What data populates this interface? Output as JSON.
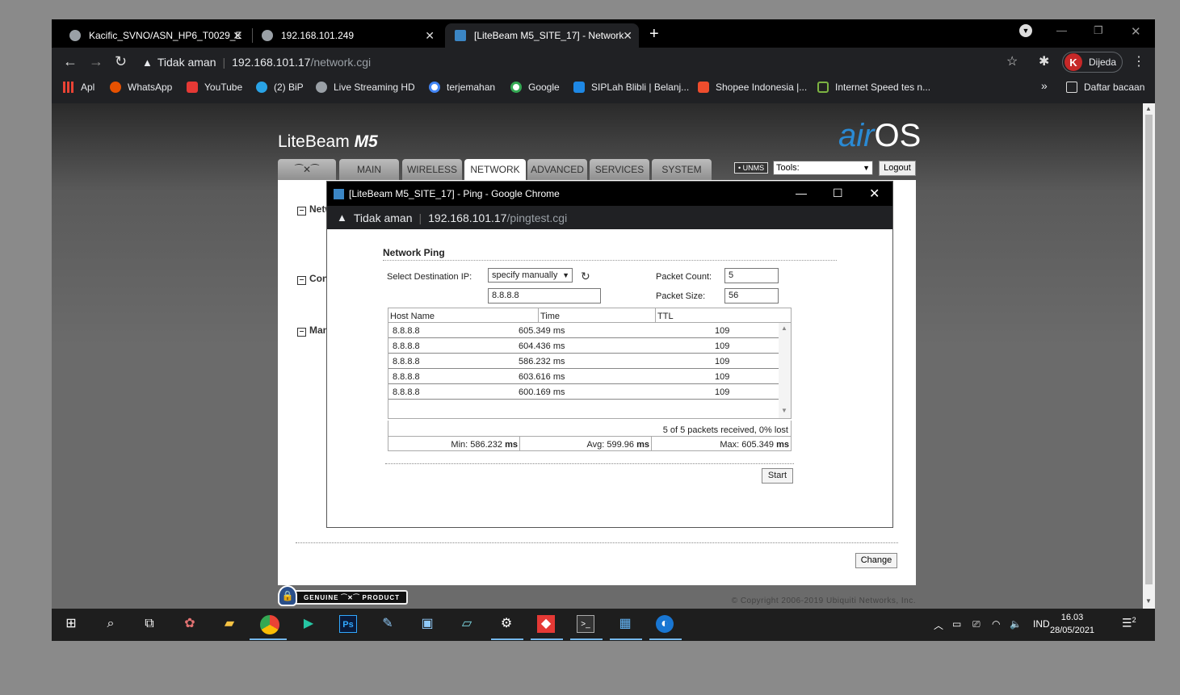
{
  "browser": {
    "tabs": [
      {
        "label": "Kacific_SVNO/ASN_HP6_T0029_E",
        "active": false
      },
      {
        "label": "192.168.101.249",
        "active": false
      },
      {
        "label": "[LiteBeam M5_SITE_17] - Network",
        "active": true
      }
    ],
    "address": {
      "warning": "Tidak aman",
      "host": "192.168.101.17",
      "path": "/network.cgi"
    },
    "profile_label": "Dijeda",
    "profile_initial": "K",
    "bookmarks": [
      "Apl",
      "WhatsApp",
      "YouTube",
      "(2) BiP",
      "Live Streaming HD",
      "terjemahan",
      "Google",
      "SIPLah Blibli | Belanj...",
      "Shopee Indonesia |...",
      "Internet Speed tes n..."
    ],
    "reading_list": "Daftar bacaan",
    "overflow": "»"
  },
  "airos": {
    "brand": "LiteBeam",
    "model": "M5",
    "logo_air": "air",
    "logo_os": "OS",
    "tabs": [
      "MAIN",
      "WIRELESS",
      "NETWORK",
      "ADVANCED",
      "SERVICES",
      "SYSTEM"
    ],
    "active_tab": "NETWORK",
    "unms": "UNMS",
    "tools_placeholder": "Tools:",
    "logout": "Logout",
    "sections": [
      "Netw",
      "Con",
      "Man"
    ],
    "change": "Change",
    "genuine": "GENUINE",
    "product": "PRODUCT",
    "copyright": "© Copyright 2006-2019 Ubiquiti Networks, Inc."
  },
  "popup": {
    "title": "[LiteBeam M5_SITE_17] - Ping - Google Chrome",
    "address": {
      "warning": "Tidak aman",
      "host": "192.168.101.17",
      "path": "/pingtest.cgi"
    },
    "heading": "Network Ping",
    "dest_label": "Select Destination IP:",
    "dest_select": "specify manually",
    "dest_ip": "8.8.8.8",
    "packet_count_label": "Packet Count:",
    "packet_count": "5",
    "packet_size_label": "Packet Size:",
    "packet_size": "56",
    "columns": [
      "Host Name",
      "Time",
      "TTL"
    ],
    "rows": [
      {
        "host": "8.8.8.8",
        "time": "605.349 ms",
        "ttl": "109"
      },
      {
        "host": "8.8.8.8",
        "time": "604.436 ms",
        "ttl": "109"
      },
      {
        "host": "8.8.8.8",
        "time": "586.232 ms",
        "ttl": "109"
      },
      {
        "host": "8.8.8.8",
        "time": "603.616 ms",
        "ttl": "109"
      },
      {
        "host": "8.8.8.8",
        "time": "600.169 ms",
        "ttl": "109"
      }
    ],
    "received": "5 of 5 packets received, 0% lost",
    "min": "Min: 586.232",
    "avg": "Avg: 599.96",
    "max": "Max: 605.349",
    "unit": "ms",
    "start": "Start"
  },
  "taskbar": {
    "language": "IND",
    "time": "16.03",
    "date": "28/05/2021",
    "notifications": "2"
  }
}
